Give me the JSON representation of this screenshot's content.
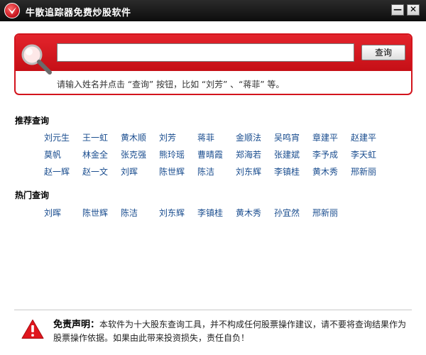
{
  "window": {
    "title": "牛散追踪器免费炒股软件",
    "minimize_label": "—",
    "close_label": "✕"
  },
  "search": {
    "value": "",
    "placeholder": "",
    "button_label": "查询",
    "hint": "请输入姓名并点击 “查询” 按钮，比如 “刘芳” 、“蒋菲” 等。"
  },
  "recommended": {
    "title": "推荐查询",
    "rows": [
      [
        "刘元生",
        "王一虹",
        "黄木顺",
        "刘芳",
        "蒋菲",
        "金顺法",
        "吴鸣宵",
        "章建平",
        "赵建平"
      ],
      [
        "莫帆",
        "林金全",
        "张克强",
        "熊玲瑶",
        "曹晴霞",
        "郑海若",
        "张建斌",
        "李予成",
        "李天虹"
      ],
      [
        "赵一辉",
        "赵一文",
        "刘晖",
        "陈世辉",
        "陈洁",
        "刘东辉",
        "李镇桂",
        "黄木秀",
        "邢新丽"
      ]
    ]
  },
  "popular": {
    "title": "热门查询",
    "items": [
      "刘晖",
      "陈世辉",
      "陈洁",
      "刘东辉",
      "李镇桂",
      "黄木秀",
      "孙宜然",
      "邢新丽"
    ]
  },
  "disclaimer": {
    "label": "免责声明：",
    "text": "本软件为十大股东查询工具，并不构成任何股票操作建议，请不要将查询结果作为股票操作依据。如果由此带来投资损失，责任自负！"
  },
  "colors": {
    "accent_red": "#d3141d",
    "link_blue": "#1a4d8f",
    "titlebar": "#1a1a1a"
  },
  "icons": {
    "app": "red-bird-logo-icon",
    "search": "magnifier-icon",
    "warning": "warning-triangle-icon"
  }
}
